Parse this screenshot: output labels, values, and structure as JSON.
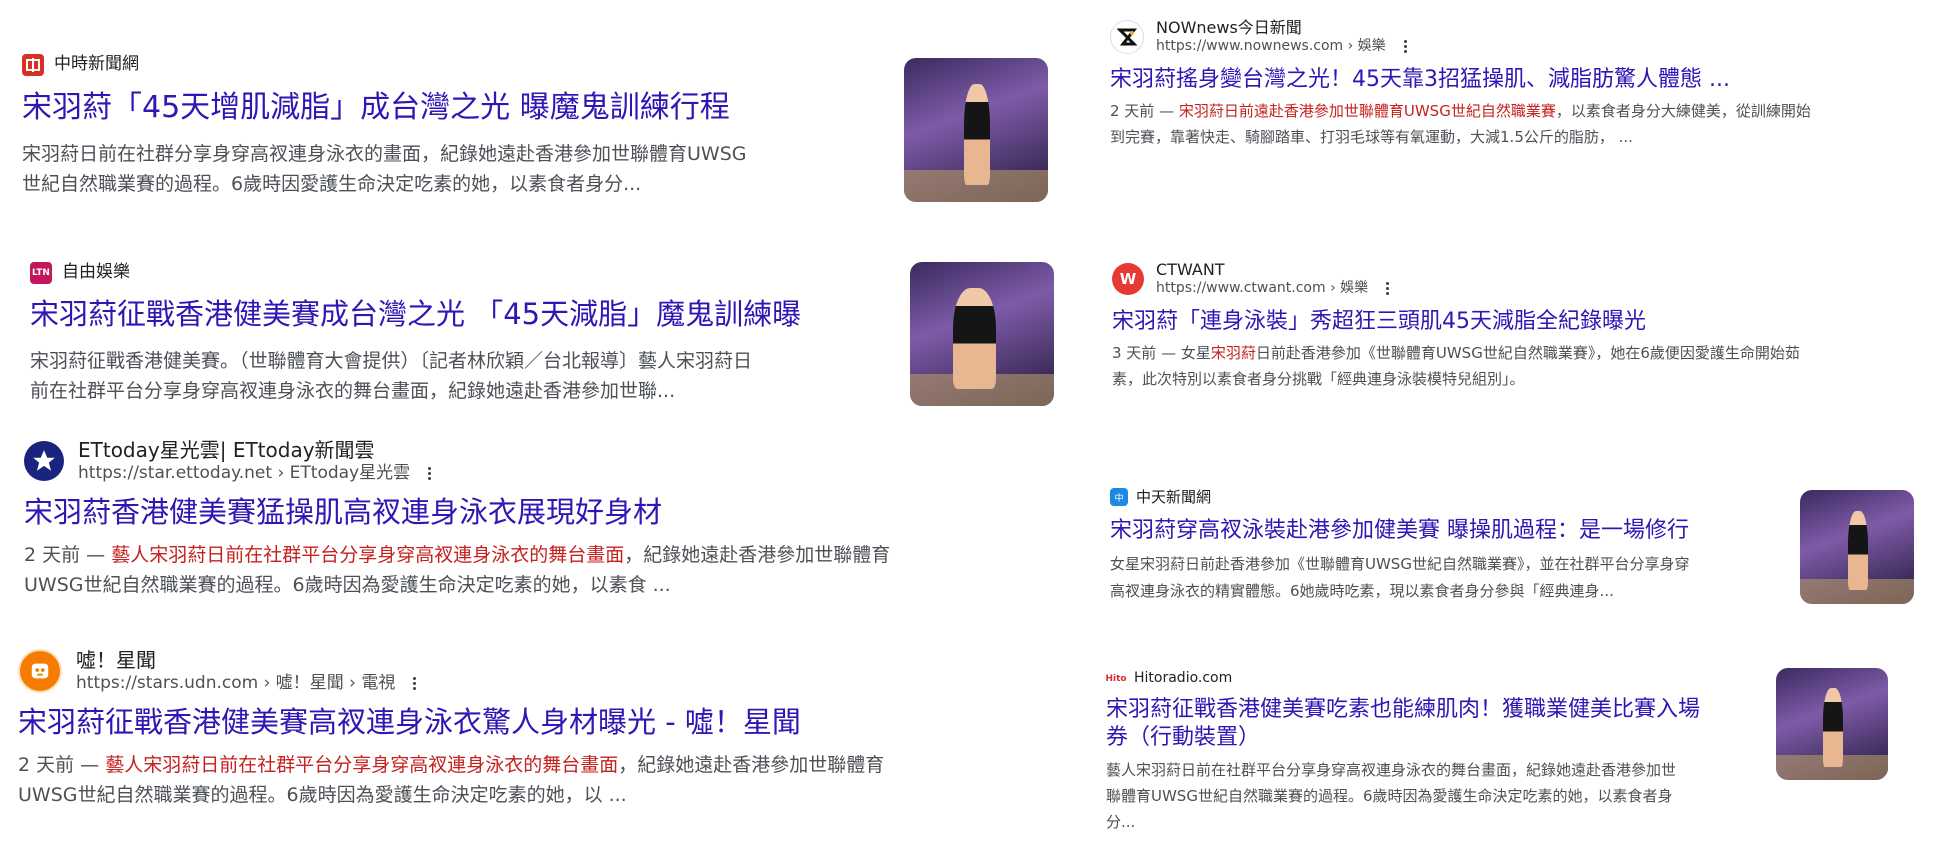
{
  "left": {
    "r1": {
      "source": "中時新聞網",
      "title": "宋羽葤「45天增肌減脂」成台灣之光 曝魔鬼訓練行程",
      "snippet_l1": "宋羽葤日前在社群分享身穿高衩連身泳衣的畫面，紀錄她遠赴香港參加世聯體育UWSG",
      "snippet_l2": "世紀自然職業賽的過程。6歲時因愛護生命決定吃素的她，以素食者身分..."
    },
    "r2": {
      "source": "自由娛樂",
      "title": "宋羽葤征戰香港健美賽成台灣之光 「45天減脂」魔鬼訓練曝",
      "snippet_l1": "宋羽葤征戰香港健美賽。（世聯體育大會提供）〔記者林欣穎／台北報導〕藝人宋羽葤日",
      "snippet_l2": "前在社群平台分享身穿高衩連身泳衣的舞台畫面，紀錄她遠赴香港參加世聯..."
    },
    "r3": {
      "source": "ETtoday星光雲| ETtoday新聞雲",
      "url": "https://star.ettoday.net › ETtoday星光雲",
      "title": "宋羽葤香港健美賽猛操肌高衩連身泳衣展現好身材",
      "date": "2 天前 — ",
      "hl": "藝人宋羽葤日前在社群平台分享身穿高衩連身泳衣的舞台畫面",
      "rest1": "，紀錄她遠赴香港參加世聯體育",
      "l2": "UWSG世紀自然職業賽的過程。6歲時因為愛護生命決定吃素的她，以素食 ..."
    },
    "r4": {
      "source": "噓！星聞",
      "url": "https://stars.udn.com › 噓！星聞 › 電視",
      "title": "宋羽葤征戰香港健美賽高衩連身泳衣驚人身材曝光 - 噓！星聞",
      "date": "2 天前 — ",
      "hl": "藝人宋羽葤日前在社群平台分享身穿高衩連身泳衣的舞台畫面",
      "rest1": "，紀錄她遠赴香港參加世聯體育",
      "l2": "UWSG世紀自然職業賽的過程。6歲時因為愛護生命決定吃素的她，以 ..."
    }
  },
  "right": {
    "r1": {
      "source": "NOWnews今日新聞",
      "url": "https://www.nownews.com › 娛樂",
      "title": "宋羽葤搖身變台灣之光！45天靠3招猛操肌、減脂肪驚人體態 ...",
      "date": "2 天前 — ",
      "hl": "宋羽葤日前遠赴香港參加世聯體育UWSG世紀自然職業賽",
      "rest1": "，以素食者身分大練健美，從訓練開始",
      "l2": "到完賽，靠著快走、騎腳踏車、打羽毛球等有氧運動，大減1.5公斤的脂肪， ..."
    },
    "r2": {
      "source": "CTWANT",
      "url": "https://www.ctwant.com › 娛樂",
      "title": "宋羽葤「連身泳裝」秀超狂三頭肌45天減脂全紀錄曝光",
      "date": "3 天前 — 女星",
      "hl": "宋羽葤",
      "rest1": "日前赴香港參加《世聯體育UWSG世紀自然職業賽》，她在6歲便因愛護生命開始茹",
      "l2": "素，此次特別以素食者身分挑戰「經典連身泳裝模特兒組別」。"
    },
    "r3": {
      "source": "中天新聞網",
      "title": "宋羽葤穿高衩泳裝赴港參加健美賽 曝操肌過程：是一場修行",
      "snippet_l1": "女星宋羽葤日前赴香港參加《世聯體育UWSG世紀自然職業賽》，並在社群平台分享身穿",
      "snippet_l2": "高衩連身泳衣的精實體態。6她歲時吃素，現以素食者身分參與「經典連身..."
    },
    "r4": {
      "source": "Hitoradio.com",
      "title_l1": "宋羽葤征戰香港健美賽吃素也能練肌肉！獲職業健美比賽入場",
      "title_l2": "券（行動裝置）",
      "snippet_l1": "藝人宋羽葤日前在社群平台分享身穿高衩連身泳衣的舞台畫面，紀錄她遠赴香港參加世",
      "snippet_l2": "聯體育UWSG世紀自然職業賽的過程。6歲時因為愛護生命決定吃素的她，以素食者身",
      "snippet_l3": "分..."
    }
  },
  "icons": {
    "chinatimes": "chinatimes-logo-icon",
    "ltn": "ltn-logo-icon",
    "ettoday": "ettoday-star-logo-icon",
    "udn": "udn-stars-logo-icon",
    "nownews": "nownews-logo-icon",
    "ctwant": "ctwant-logo-icon",
    "ctitv": "ctitv-logo-icon",
    "hito": "hitoradio-logo-icon",
    "more": "more-vert-icon"
  },
  "colors": {
    "title": "#3215b5",
    "highlight": "#c5221f",
    "snippet": "#4d5156"
  }
}
